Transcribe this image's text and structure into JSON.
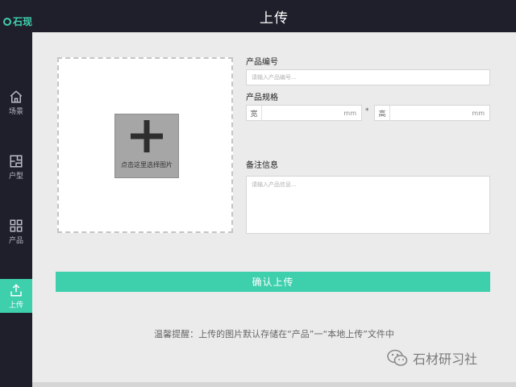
{
  "app": {
    "logo_text": "石现",
    "title": "上传"
  },
  "sidebar": {
    "items": [
      {
        "label": "场景",
        "icon": "home-icon"
      },
      {
        "label": "户型",
        "icon": "floorplan-icon"
      },
      {
        "label": "产品",
        "icon": "grid-icon"
      },
      {
        "label": "上传",
        "icon": "upload-icon",
        "active": true
      }
    ]
  },
  "upload": {
    "picker_label": "点击这里选择图片",
    "icon": "plus-icon"
  },
  "form": {
    "code_label": "产品编号",
    "code_placeholder": "请输入产品编号...",
    "spec_label": "产品规格",
    "width_prefix": "宽",
    "width_unit": "mm",
    "separator": "*",
    "height_prefix": "高",
    "height_unit": "mm",
    "notes_label": "备注信息",
    "notes_placeholder": "请输入产品信息..."
  },
  "confirm_label": "确认上传",
  "tip": "温馨提醒：上传的图片默认存储在“产品”一“本地上传”文件中",
  "watermark": "石材研习社",
  "colors": {
    "accent": "#3ecfad",
    "sidebar_bg": "#1f1f2b",
    "content_bg": "#ebebeb"
  }
}
